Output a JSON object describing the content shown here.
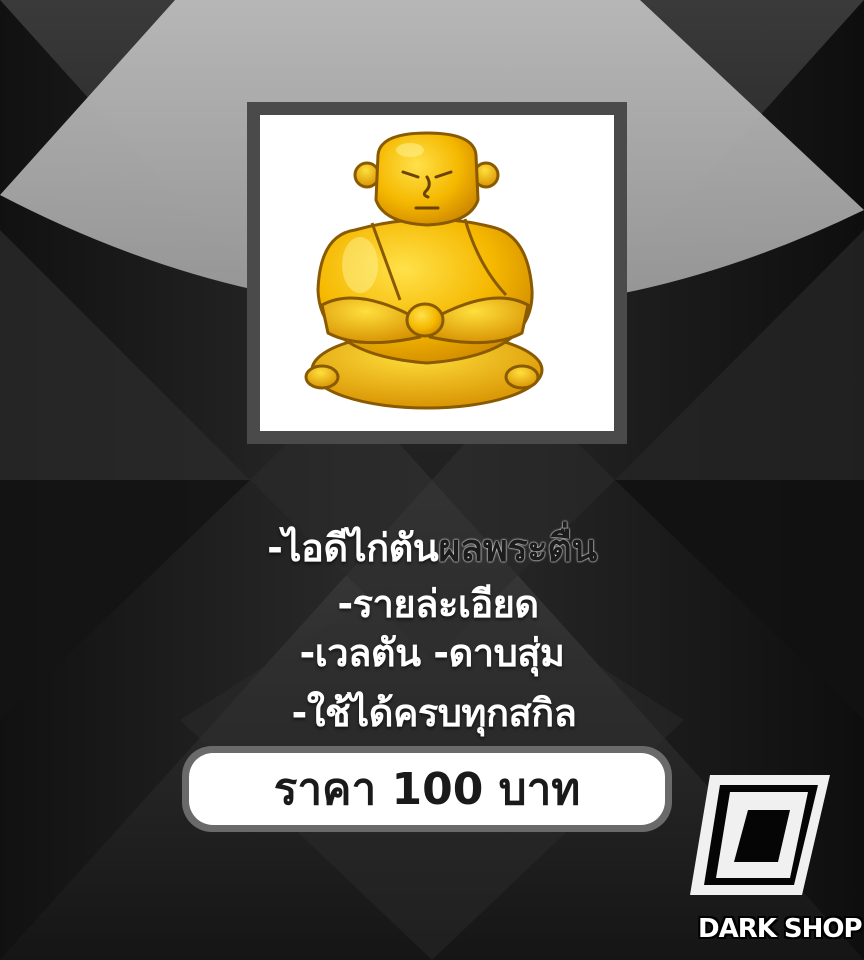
{
  "product": {
    "image_icon": "golden-buddha-fruit-icon"
  },
  "details": {
    "line1_prefix": "-ไอดีไก่ตัน",
    "line1_highlight": "ผลพระตื่น",
    "line2": "-รายล่ะเอียด",
    "line3": "-เวลตัน -ดาบสุ่ม",
    "line4": "-ใช้ได้ครบทุกสกิล"
  },
  "price": {
    "label": "ราคา 100 บาท"
  },
  "brand": {
    "logo_icon": "dark-d-logo-icon",
    "name": "DARK SHOP"
  },
  "colors": {
    "background": "#1a1a1a",
    "gold": "#f2b705",
    "frame": "#4a4a4a"
  }
}
